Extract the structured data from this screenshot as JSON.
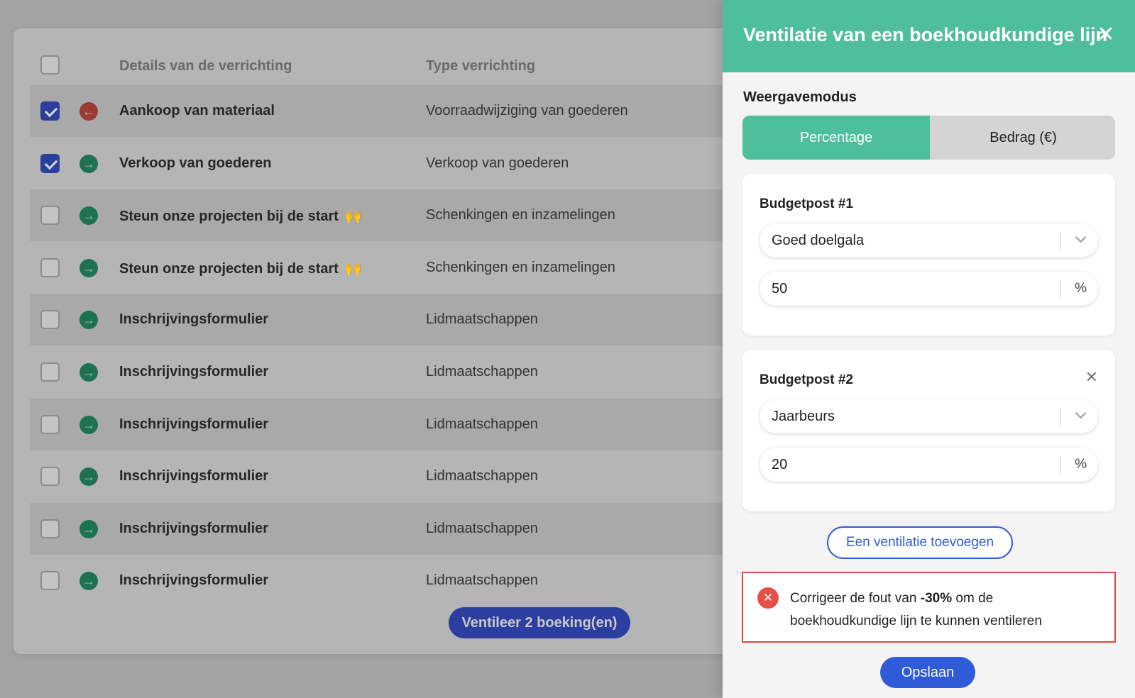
{
  "table": {
    "headers": {
      "details": "Details van de verrichting",
      "type": "Type verrichting"
    },
    "rows": [
      {
        "details": "Aankoop van materiaal",
        "type": "Voorraadwijziging van goederen",
        "checked": true,
        "direction": "out",
        "emoji": ""
      },
      {
        "details": "Verkoop van goederen",
        "type": "Verkoop van goederen",
        "checked": true,
        "direction": "in",
        "emoji": ""
      },
      {
        "details": "Steun onze projecten bij de start",
        "type": "Schenkingen en inzamelingen",
        "checked": false,
        "direction": "in",
        "emoji": "🙌"
      },
      {
        "details": "Steun onze projecten bij de start",
        "type": "Schenkingen en inzamelingen",
        "checked": false,
        "direction": "in",
        "emoji": "🙌"
      },
      {
        "details": "Inschrijvingsformulier",
        "type": "Lidmaatschappen",
        "checked": false,
        "direction": "in",
        "emoji": ""
      },
      {
        "details": "Inschrijvingsformulier",
        "type": "Lidmaatschappen",
        "checked": false,
        "direction": "in",
        "emoji": ""
      },
      {
        "details": "Inschrijvingsformulier",
        "type": "Lidmaatschappen",
        "checked": false,
        "direction": "in",
        "emoji": ""
      },
      {
        "details": "Inschrijvingsformulier",
        "type": "Lidmaatschappen",
        "checked": false,
        "direction": "in",
        "emoji": ""
      },
      {
        "details": "Inschrijvingsformulier",
        "type": "Lidmaatschappen",
        "checked": false,
        "direction": "in",
        "emoji": ""
      },
      {
        "details": "Inschrijvingsformulier",
        "type": "Lidmaatschappen",
        "checked": false,
        "direction": "in",
        "emoji": ""
      }
    ],
    "ventileer_button": "Ventileer 2 boeking(en)"
  },
  "panel": {
    "title": "Ventilatie van een boekhoudkundige lijn",
    "close_icon": "close-icon",
    "mode_label": "Weergavemodus",
    "modes": {
      "active": "Percentage",
      "inactive": "Bedrag (€)"
    },
    "budgetposts": [
      {
        "title": "Budgetpost #1",
        "select_value": "Goed doelgala",
        "amount": "50",
        "unit": "%"
      },
      {
        "title": "Budgetpost #2",
        "select_value": "Jaarbeurs",
        "amount": "20",
        "unit": "%"
      }
    ],
    "add_button": "Een ventilatie toevoegen",
    "error": {
      "prefix": "Corrigeer de fout van ",
      "value": "-30%",
      "suffix": " om de boekhoudkundige lijn te kunnen ventileren"
    },
    "save_button": "Opslaan"
  },
  "colors": {
    "accent": "#4fbe9b",
    "primary_blue": "#2f5bd8",
    "error_red": "#d94a45"
  }
}
